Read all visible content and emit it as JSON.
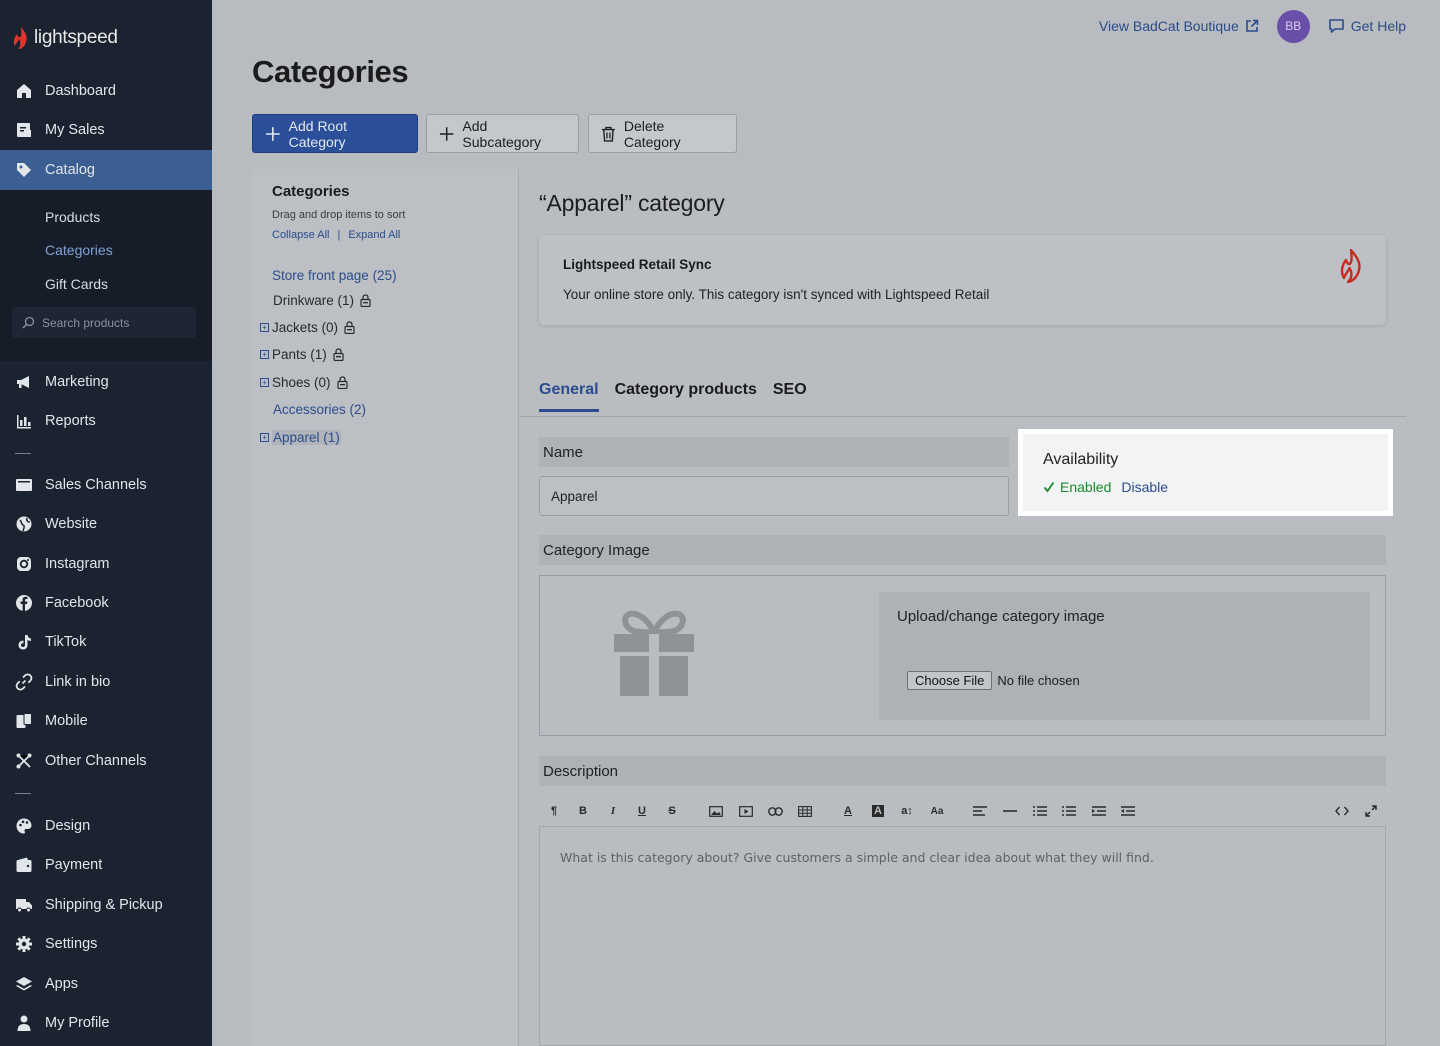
{
  "brand": {
    "name": "lightspeed"
  },
  "sidebar": {
    "nav": [
      {
        "label": "Dashboard",
        "icon": "home-icon"
      },
      {
        "label": "My Sales",
        "icon": "sales-icon"
      },
      {
        "label": "Catalog",
        "icon": "tag-icon",
        "active": true
      }
    ],
    "catalog_sub": [
      {
        "label": "Products"
      },
      {
        "label": "Categories",
        "active": true
      },
      {
        "label": "Gift Cards"
      }
    ],
    "search_placeholder": "Search products",
    "nav2": [
      {
        "label": "Marketing",
        "icon": "megaphone-icon"
      },
      {
        "label": "Reports",
        "icon": "chart-icon"
      }
    ],
    "channels": [
      {
        "label": "Sales Channels",
        "icon": "store-icon"
      },
      {
        "label": "Website",
        "icon": "globe-icon"
      },
      {
        "label": "Instagram",
        "icon": "instagram-icon"
      },
      {
        "label": "Facebook",
        "icon": "facebook-icon"
      },
      {
        "label": "TikTok",
        "icon": "tiktok-icon"
      },
      {
        "label": "Link in bio",
        "icon": "link-icon"
      },
      {
        "label": "Mobile",
        "icon": "mobile-icon"
      },
      {
        "label": "Other Channels",
        "icon": "channels-icon"
      }
    ],
    "settings": [
      {
        "label": "Design",
        "icon": "palette-icon"
      },
      {
        "label": "Payment",
        "icon": "wallet-icon"
      },
      {
        "label": "Shipping & Pickup",
        "icon": "truck-icon"
      },
      {
        "label": "Settings",
        "icon": "gear-icon"
      },
      {
        "label": "Apps",
        "icon": "layers-icon"
      },
      {
        "label": "My Profile",
        "icon": "user-icon"
      }
    ]
  },
  "header": {
    "view_store": "View BadCat Boutique",
    "avatar_initials": "BB",
    "help": "Get Help"
  },
  "page": {
    "title": "Categories",
    "buttons": {
      "add_root": "Add Root Category",
      "add_sub": "Add Subcategory",
      "delete": "Delete Category"
    }
  },
  "tree": {
    "title": "Categories",
    "hint": "Drag and drop items to sort",
    "collapse": "Collapse All",
    "separator": "|",
    "expand": "Expand All",
    "items": [
      {
        "label": "Store front page (25)"
      },
      {
        "label": "Drinkware (1)"
      },
      {
        "label": "Jackets (0)"
      },
      {
        "label": "Pants (1)"
      },
      {
        "label": "Shoes (0)"
      },
      {
        "label": "Accessories (2)"
      },
      {
        "label": "Apparel (1)"
      }
    ]
  },
  "detail": {
    "heading": "“Apparel” category",
    "sync": {
      "title": "Lightspeed Retail Sync",
      "desc": "Your online store only. This category isn't synced with Lightspeed Retail"
    },
    "tabs": [
      "General",
      "Category products",
      "SEO"
    ],
    "name_label": "Name",
    "name_value": "Apparel",
    "availability": {
      "title": "Availability",
      "enabled": "Enabled",
      "disable": "Disable"
    },
    "image_label": "Category Image",
    "upload_title": "Upload/change category image",
    "choose_file": "Choose File",
    "no_file": "No file chosen",
    "description_label": "Description",
    "editor_placeholder": "What is this category about? Give customers a simple and clear idea about what they will find."
  },
  "colors": {
    "sidebar_bg": "#1b2330",
    "active_nav": "#3b5f93",
    "primary": "#2b4f99",
    "enabled_green": "#1d8a2b",
    "link_blue": "#2b4c8e"
  }
}
